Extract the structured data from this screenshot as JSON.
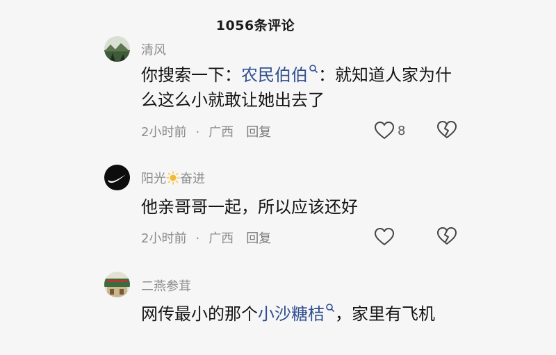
{
  "header": {
    "title": "1056条评论"
  },
  "comments": [
    {
      "username": "清风",
      "text_before": "你搜索一下：",
      "link_text": "农民伯伯",
      "text_after": "：就知道人家为什么这么小就敢让她出去了",
      "time": "2小时前",
      "dot": "·",
      "location": "广西",
      "reply_label": "回复",
      "like_count": "8",
      "avatar_icon": "landscape-avatar"
    },
    {
      "username_before": "阳光",
      "username_after": "奋进",
      "username_emoji_icon": "sun-icon",
      "text": "他亲哥哥一起，所以应该还好",
      "time": "2小时前",
      "dot": "·",
      "location": "广西",
      "reply_label": "回复",
      "avatar_icon": "swoosh-avatar"
    },
    {
      "username": "二燕参茸",
      "text_before": "网传最小的那个",
      "link_text": "小沙糖桔",
      "text_after": "，家里有飞机",
      "avatar_icon": "shop-avatar"
    }
  ],
  "icons": {
    "like": "heart-outline-icon",
    "dislike": "broken-heart-icon",
    "search": "search-icon"
  },
  "colors": {
    "background": "#f6f6f7",
    "link": "#2f4f8f",
    "meta": "#8c8c8c"
  }
}
